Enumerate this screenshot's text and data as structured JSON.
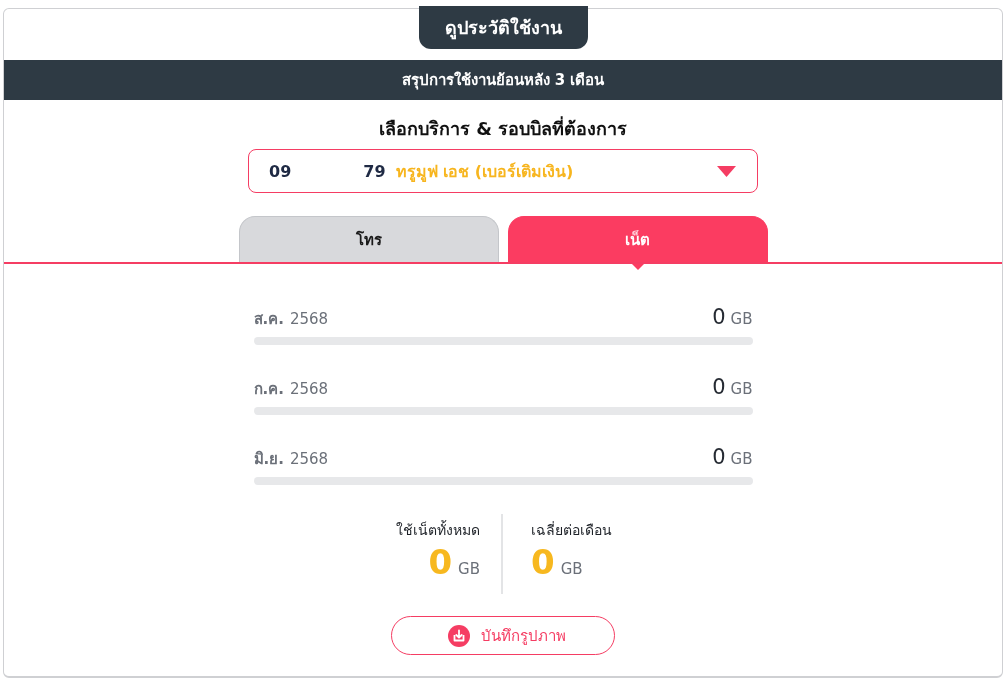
{
  "header": {
    "title": "ดูประวัติใช้งาน",
    "summary": "สรุปการใช้งานย้อนหลัง 3 เดือน"
  },
  "selector": {
    "heading": "เลือกบริการ & รอบบิลที่ต้องการ",
    "number_start": "09",
    "number_end": "79",
    "package": "ทรูมูฟ เอช (เบอร์เติมเงิน)"
  },
  "tabs": [
    {
      "label": "โทร",
      "selected": false
    },
    {
      "label": "เน็ต",
      "selected": true
    }
  ],
  "usage": [
    {
      "month": "ส.ค.",
      "year": "2568",
      "amount": "0",
      "unit": "GB"
    },
    {
      "month": "ก.ค.",
      "year": "2568",
      "amount": "0",
      "unit": "GB"
    },
    {
      "month": "มิ.ย.",
      "year": "2568",
      "amount": "0",
      "unit": "GB"
    }
  ],
  "totals": [
    {
      "label": "ใช้เน็ตทั้งหมด",
      "value": "0",
      "unit": "GB"
    },
    {
      "label": "เฉลี่ยต่อเดือน",
      "value": "0",
      "unit": "GB"
    }
  ],
  "save_button": {
    "label": "บันทึกรูปภาพ"
  }
}
